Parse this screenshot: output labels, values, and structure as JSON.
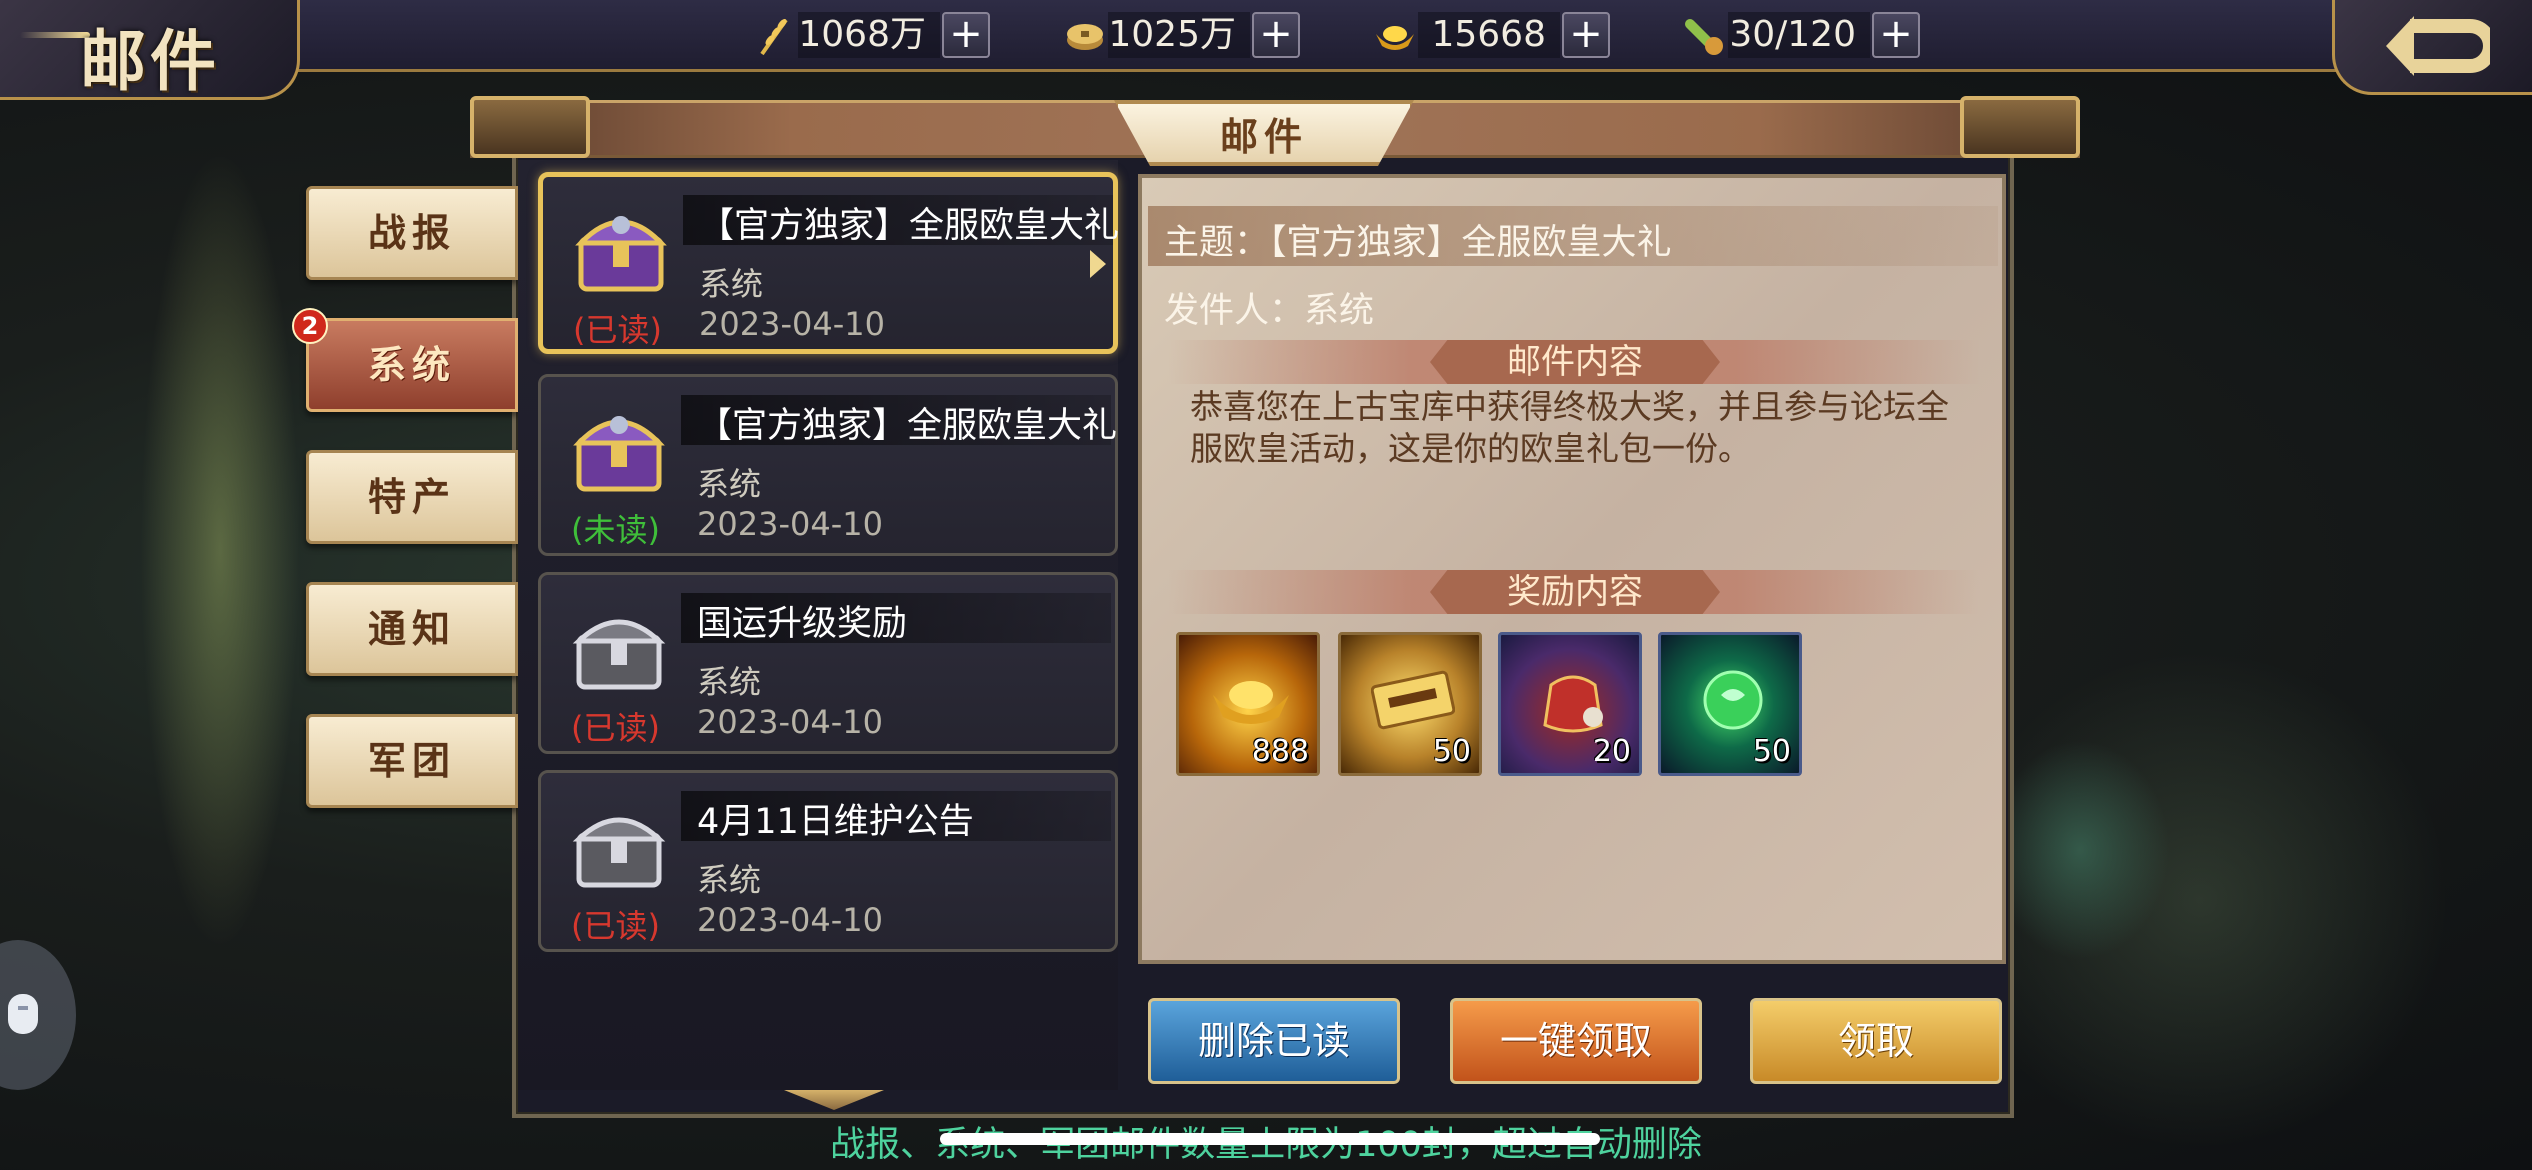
{
  "header": {
    "title": "邮件",
    "resources": [
      {
        "icon": "wheat-icon",
        "value": "1068万"
      },
      {
        "icon": "coin-icon",
        "value": "1025万"
      },
      {
        "icon": "gold-ingot-icon",
        "value": "15668"
      },
      {
        "icon": "stamina-potion-icon",
        "value": "30/120"
      }
    ],
    "plus_label": "+"
  },
  "panel": {
    "title": "邮件"
  },
  "tabs": [
    {
      "label": "战报"
    },
    {
      "label": "系统",
      "active": true,
      "badge": "2"
    },
    {
      "label": "特产"
    },
    {
      "label": "通知"
    },
    {
      "label": "军团"
    }
  ],
  "mails": [
    {
      "title": "【官方独家】全服欧皇大礼",
      "sender": "系统",
      "status": "(已读)",
      "date": "2023-04-10",
      "icon": "purple-chest-icon",
      "selected": true
    },
    {
      "title": "【官方独家】全服欧皇大礼",
      "sender": "系统",
      "status": "(未读)",
      "date": "2023-04-10",
      "icon": "purple-chest-icon"
    },
    {
      "title": "国运升级奖励",
      "sender": "系统",
      "status": "(已读)",
      "date": "2023-04-10",
      "icon": "silver-chest-icon"
    },
    {
      "title": "4月11日维护公告",
      "sender": "系统",
      "status": "(已读)",
      "date": "2023-04-10",
      "icon": "silver-chest-icon"
    }
  ],
  "detail": {
    "subject": "主题：【官方独家】全服欧皇大礼",
    "sender": "发件人：系统",
    "content_heading": "邮件内容",
    "body": "恭喜您在上古宝库中获得终极大奖，并且参与论坛全服欧皇活动，这是你的欧皇礼包一份。",
    "reward_heading": "奖励内容",
    "rewards": [
      {
        "icon": "gold-ingot-icon",
        "count": "888"
      },
      {
        "icon": "golden-token-icon",
        "count": "50"
      },
      {
        "icon": "red-pouch-icon",
        "count": "20"
      },
      {
        "icon": "green-orb-icon",
        "count": "50"
      }
    ]
  },
  "buttons": {
    "delete_read": "删除已读",
    "claim_all": "一键领取",
    "claim": "领取"
  },
  "footer": {
    "note": "战报、系统、军团邮件数量上限为100封，超过自动删除"
  }
}
